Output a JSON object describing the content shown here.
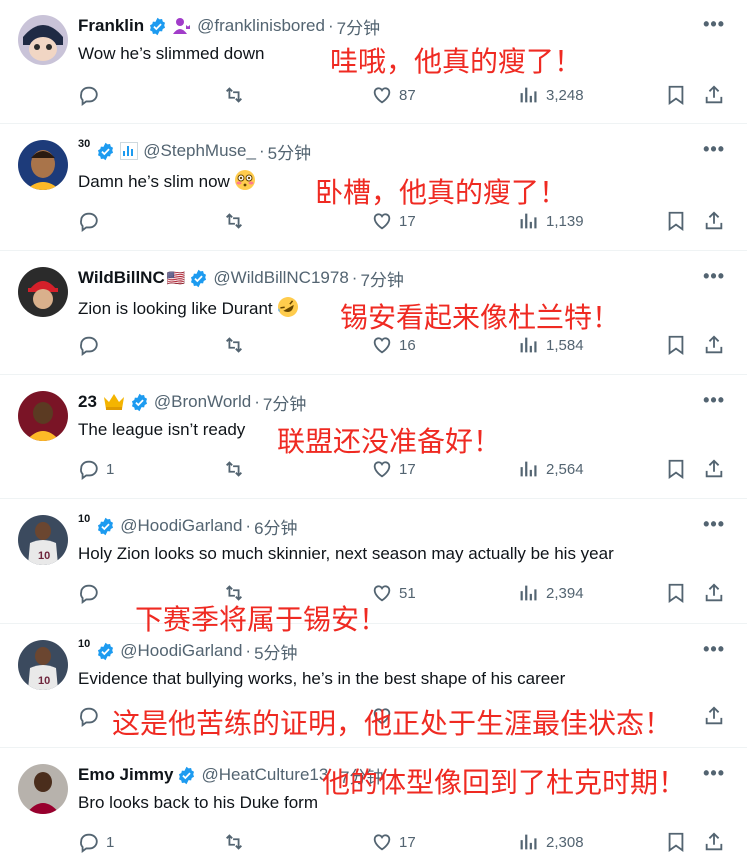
{
  "colors": {
    "accent": "#1d9bf0",
    "muted": "#536471",
    "overlay_red": "#ef2a22"
  },
  "tweets": [
    {
      "name": "Franklin",
      "sup": "",
      "flag": "",
      "affiliate": "affiliate-badge-icon",
      "handle": "@franklinisbored",
      "time": "7分钟",
      "text": "Wow he’s slimmed down",
      "emoji": "",
      "replies": "",
      "likes": "87",
      "views": "3,248",
      "avatar_icon": "cartoon-avatar"
    },
    {
      "name": "",
      "sup": "30",
      "flag": "",
      "affiliate": "chart-badge-icon",
      "handle": "@StephMuse_",
      "time": "5分钟",
      "text": "Damn he’s slim now",
      "emoji": "flushed-face-emoji",
      "replies": "",
      "likes": "17",
      "views": "1,139",
      "avatar_icon": "player-avatar"
    },
    {
      "name": "WildBillNC",
      "sup": "",
      "flag": "🇺🇸",
      "affiliate": "",
      "handle": "@WildBillNC1978",
      "time": "7分钟",
      "text": "Zion is looking like Durant",
      "emoji": "rofl-emoji",
      "replies": "",
      "likes": "16",
      "views": "1,584",
      "avatar_icon": "maga-hat-avatar"
    },
    {
      "name": "23",
      "sup": "",
      "flag": "",
      "affiliate": "crown-emoji",
      "handle": "@BronWorld",
      "time": "7分钟",
      "text": "The league isn’t ready",
      "emoji": "",
      "replies": "1",
      "likes": "17",
      "views": "2,564",
      "avatar_icon": "lebron-avatar"
    },
    {
      "name": "",
      "sup": "10",
      "flag": "",
      "affiliate": "",
      "handle": "@HoodiGarland",
      "time": "6分钟",
      "text": "Holy Zion looks so much skinnier, next season may actually be his year",
      "emoji": "",
      "replies": "",
      "likes": "51",
      "views": "2,394",
      "avatar_icon": "garland-avatar"
    },
    {
      "name": "",
      "sup": "10",
      "flag": "",
      "affiliate": "",
      "handle": "@HoodiGarland",
      "time": "5分钟",
      "text": "Evidence that bullying works, he’s in the best shape of his career",
      "emoji": "",
      "replies": "",
      "likes": "",
      "views": "",
      "avatar_icon": "garland-avatar"
    },
    {
      "name": "Emo Jimmy",
      "sup": "",
      "flag": "",
      "affiliate": "",
      "handle": "@HeatCulture13",
      "time": "7分钟",
      "text": "Bro looks back to his Duke form",
      "emoji": "",
      "replies": "1",
      "likes": "17",
      "views": "2,308",
      "avatar_icon": "jimmy-avatar"
    }
  ],
  "overlays": [
    "哇哦，他真的瘦了！",
    "卧槽，他真的瘦了！",
    "锡安看起来像杜兰特！",
    "联盟还没准备好！",
    "下赛季将属于锡安！",
    "这是他苦练的证明，他正处于生涯最佳状态！",
    "他的体型像回到了杜克时期！"
  ]
}
